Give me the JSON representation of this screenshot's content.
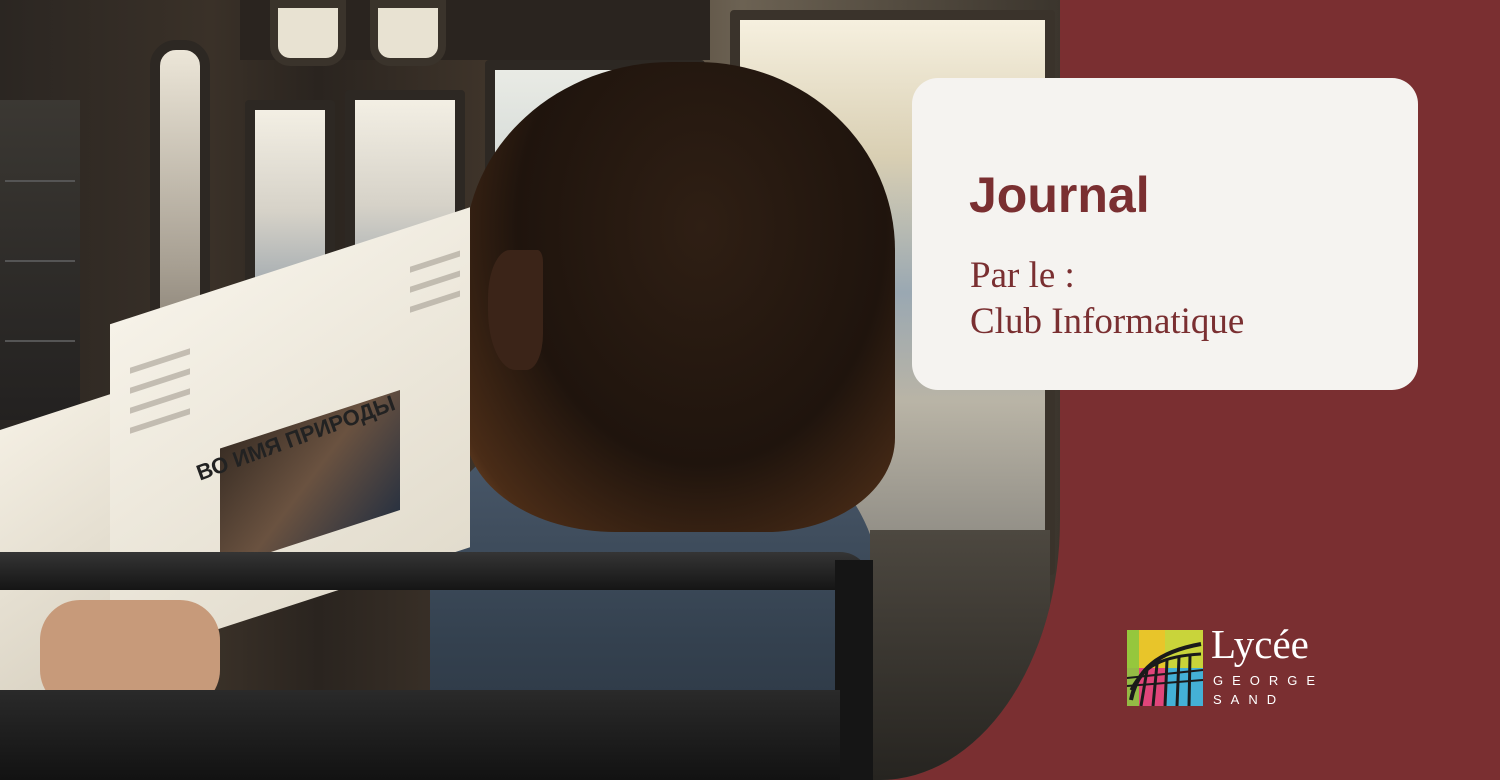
{
  "card": {
    "title": "Journal",
    "subtitle_line1": "Par le :",
    "subtitle_line2": "Club Informatique"
  },
  "logo": {
    "word": "Lycée",
    "line1": "GEORGE",
    "line2": "SAND"
  },
  "photo": {
    "newspaper_headline": "ВО ИМЯ ПРИРОДЫ"
  },
  "colors": {
    "background": "#7a2f31",
    "card": "#f5f3f0",
    "accent_text": "#7a2f31",
    "logo_text": "#ffffff"
  }
}
